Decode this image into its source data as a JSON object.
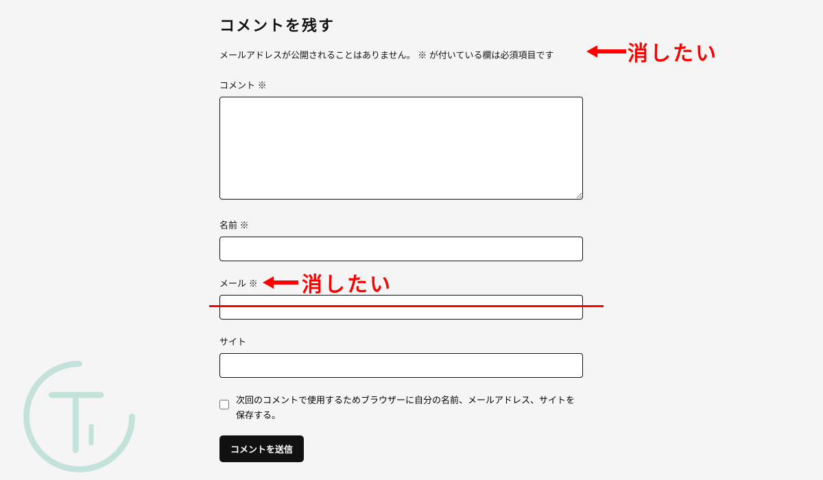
{
  "form": {
    "title": "コメントを残す",
    "note": "メールアドレスが公開されることはありません。 ※ が付いている欄は必須項目です",
    "comment_label": "コメント ※",
    "name_label": "名前 ※",
    "email_label": "メール ※",
    "site_label": "サイト",
    "consent_label": "次回のコメントで使用するためブラウザーに自分の名前、メールアドレス、サイトを保存する。",
    "submit_label": "コメントを送信"
  },
  "annotations": {
    "delete1": "消したい",
    "delete2": "消したい"
  }
}
